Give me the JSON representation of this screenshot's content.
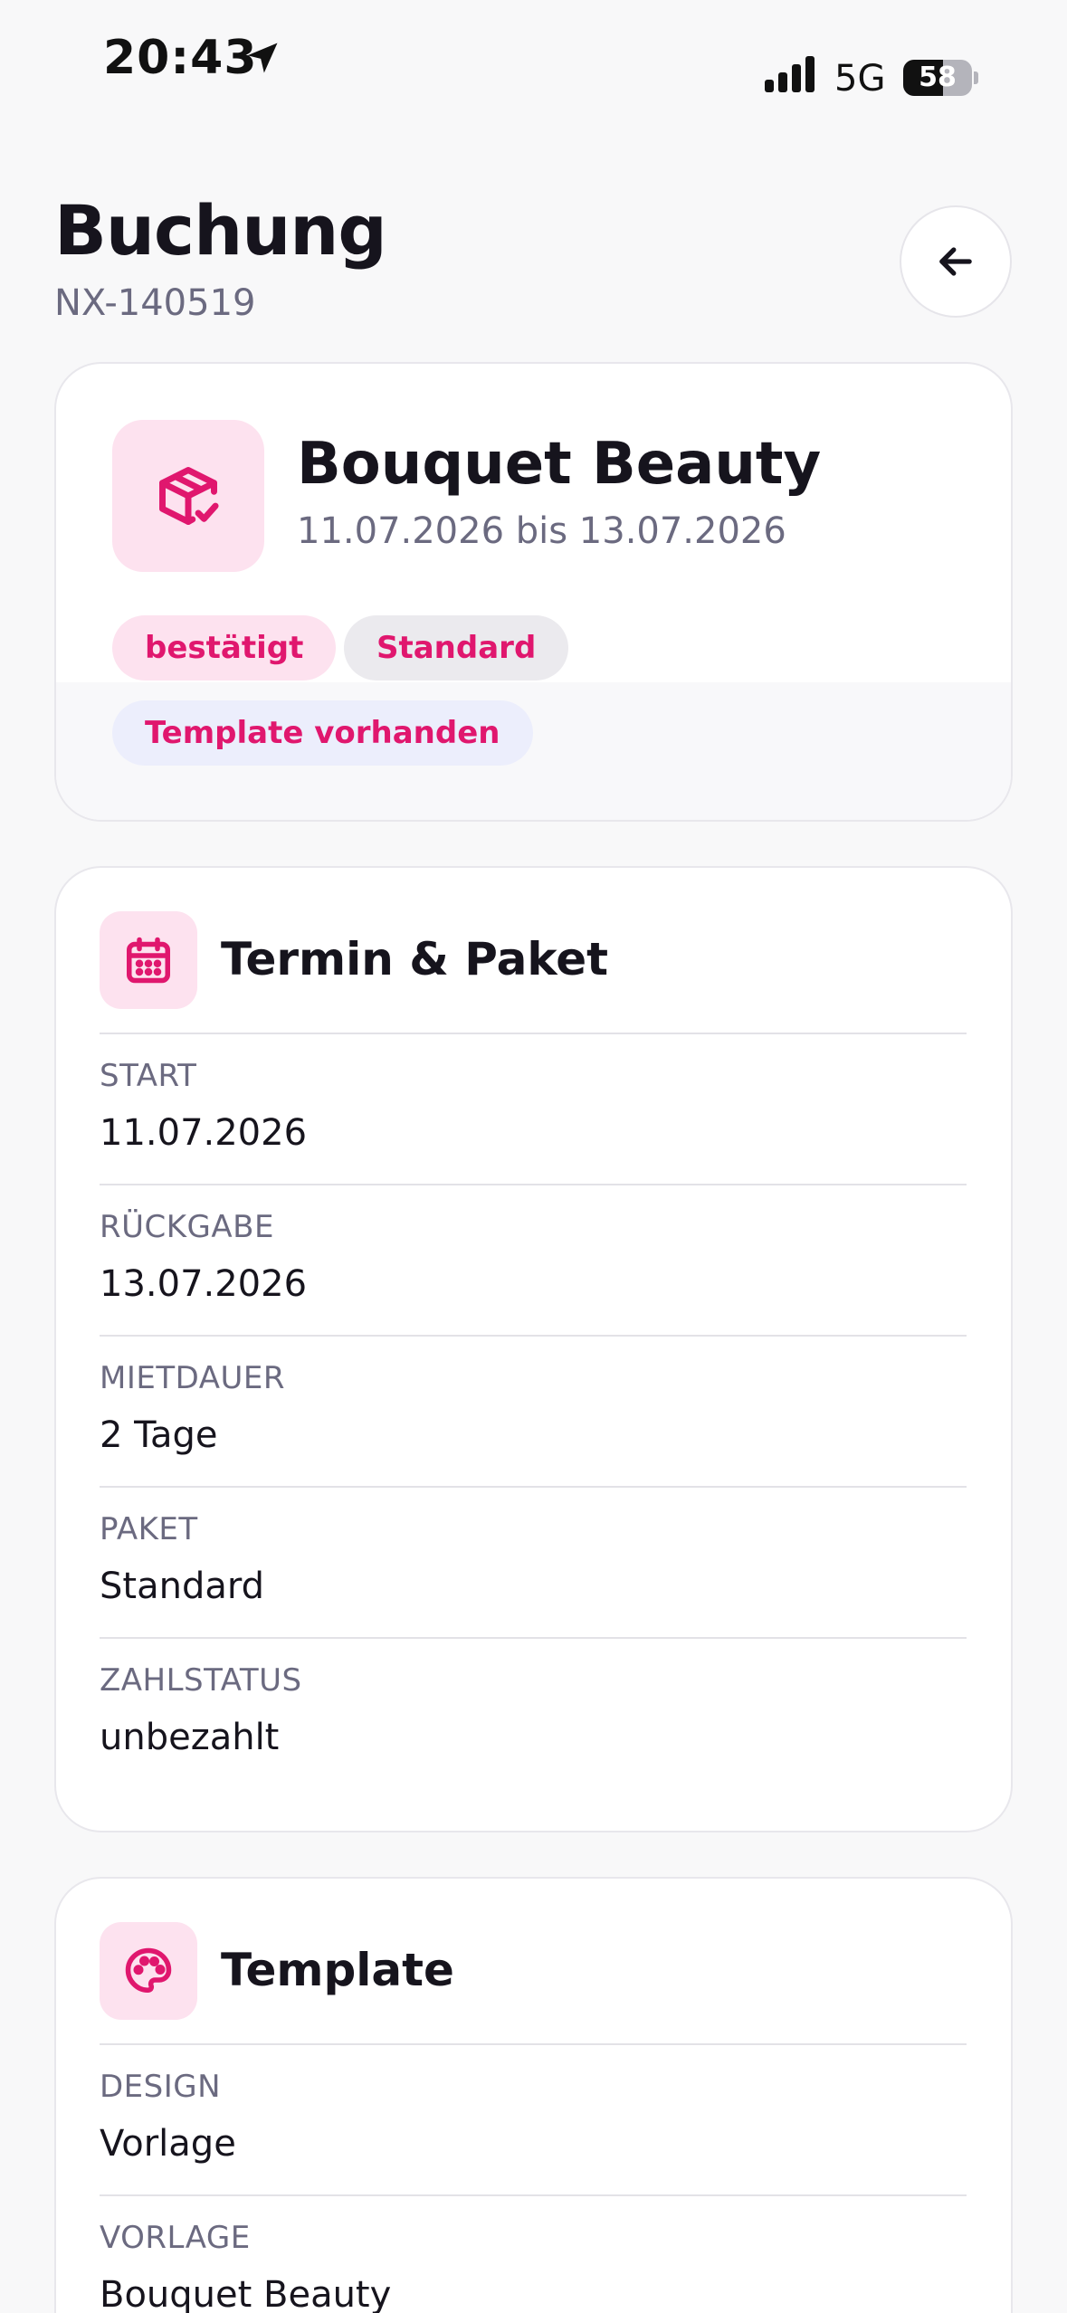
{
  "status_bar": {
    "time": "20:43",
    "network": "5G",
    "battery": "58",
    "battery_fraction": 0.58
  },
  "header": {
    "title": "Buchung",
    "booking_id": "NX-140519",
    "back_icon": "arrow-left-icon"
  },
  "summary": {
    "icon": "package-check-icon",
    "product_name": "Bouquet Beauty",
    "dates": "11.07.2026 bis 13.07.2026",
    "badges": {
      "status": "bestätigt",
      "package": "Standard",
      "template": "Template vorhanden"
    }
  },
  "termin_section": {
    "icon": "calendar-icon",
    "title": "Termin & Paket",
    "fields": [
      {
        "label": "START",
        "value": "11.07.2026"
      },
      {
        "label": "RÜCKGABE",
        "value": "13.07.2026"
      },
      {
        "label": "MIETDAUER",
        "value": "2 Tage"
      },
      {
        "label": "PAKET",
        "value": "Standard"
      },
      {
        "label": "ZAHLSTATUS",
        "value": "unbezahlt"
      }
    ]
  },
  "template_section": {
    "icon": "palette-icon",
    "title": "Template",
    "fields": [
      {
        "label": "DESIGN",
        "value": "Vorlage"
      },
      {
        "label": "VORLAGE",
        "value": "Bouquet Beauty"
      }
    ]
  },
  "colors": {
    "accent": "#e0176e",
    "accent_soft": "#fde2ef",
    "text_primary": "#16141d",
    "text_secondary": "#6b6a80",
    "background": "#f8f8f9"
  }
}
